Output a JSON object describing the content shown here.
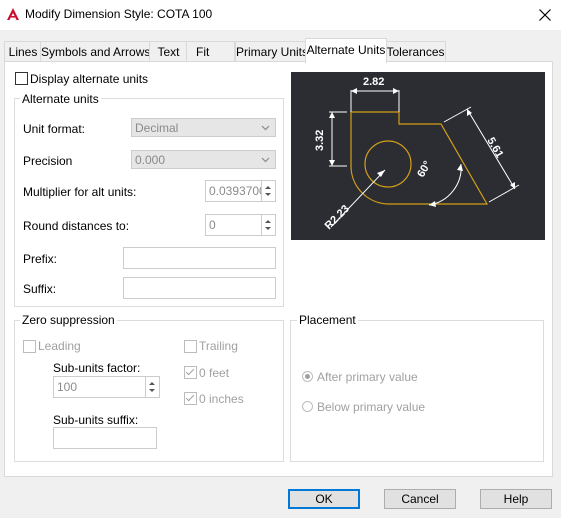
{
  "window": {
    "title": "Modify Dimension Style: COTA 100"
  },
  "tabs": [
    {
      "label": "Lines"
    },
    {
      "label": "Symbols and Arrows"
    },
    {
      "label": "Text"
    },
    {
      "label": "Fit"
    },
    {
      "label": "Primary Units"
    },
    {
      "label": "Alternate Units",
      "active": true
    },
    {
      "label": "Tolerances"
    }
  ],
  "display_alt_units": {
    "label": "Display alternate units",
    "checked": false
  },
  "alternate_units": {
    "group_label": "Alternate units",
    "unit_format": {
      "label": "Unit format:",
      "value": "Decimal"
    },
    "precision": {
      "label": "Precision",
      "value": "0.000"
    },
    "multiplier": {
      "label": "Multiplier for alt units:",
      "value": "0.0393700"
    },
    "round_distances": {
      "label": "Round distances  to:",
      "value": "0"
    },
    "prefix": {
      "label": "Prefix:",
      "value": ""
    },
    "suffix": {
      "label": "Suffix:",
      "value": ""
    }
  },
  "zero_suppression": {
    "group_label": "Zero suppression",
    "leading": {
      "label": "Leading",
      "checked": false
    },
    "trailing": {
      "label": "Trailing",
      "checked": false
    },
    "zero_feet": {
      "label": "0 feet",
      "checked": true
    },
    "zero_inches": {
      "label": "0 inches",
      "checked": true
    },
    "sub_units_factor": {
      "label": "Sub-units factor:",
      "value": "100"
    },
    "sub_units_suffix": {
      "label": "Sub-units suffix:",
      "value": ""
    }
  },
  "placement": {
    "group_label": "Placement",
    "after_primary": {
      "label": "After primary value",
      "selected": true
    },
    "below_primary": {
      "label": "Below primary value",
      "selected": false
    }
  },
  "preview": {
    "dim_top": "2.82",
    "dim_left": "3.32",
    "dim_right": "5.61",
    "dim_radius": "R2.23",
    "dim_angle": "60°",
    "colors": {
      "background": "#2b2d33",
      "geometry": "#d4a017",
      "dimension": "#ffffff"
    }
  },
  "buttons": {
    "ok": "OK",
    "cancel": "Cancel",
    "help": "Help"
  },
  "colors": {
    "focus_border": "#0078d7",
    "app_icon": "#c8102e"
  }
}
